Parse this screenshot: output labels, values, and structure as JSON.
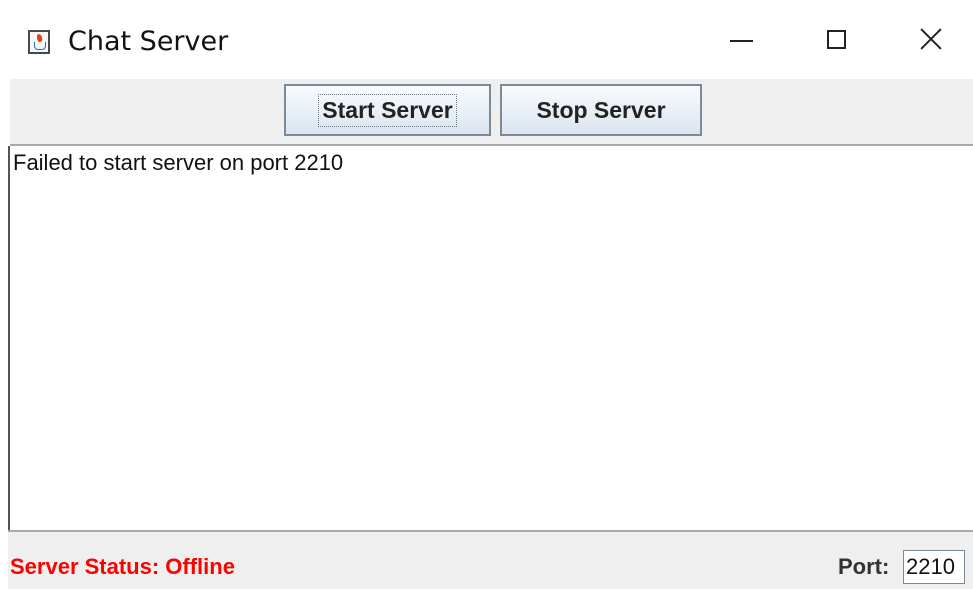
{
  "window": {
    "title": "Chat Server",
    "icon": "java-icon"
  },
  "toolbar": {
    "start_label": "Start Server",
    "stop_label": "Stop Server"
  },
  "log": {
    "lines": [
      "Failed to start server on port 2210"
    ]
  },
  "status": {
    "text": "Server Status: Offline",
    "color": "#ff0000"
  },
  "port": {
    "label": "Port:",
    "value": "2210"
  },
  "colors": {
    "panel_bg": "#efefef",
    "button_border": "#7a8a99"
  }
}
